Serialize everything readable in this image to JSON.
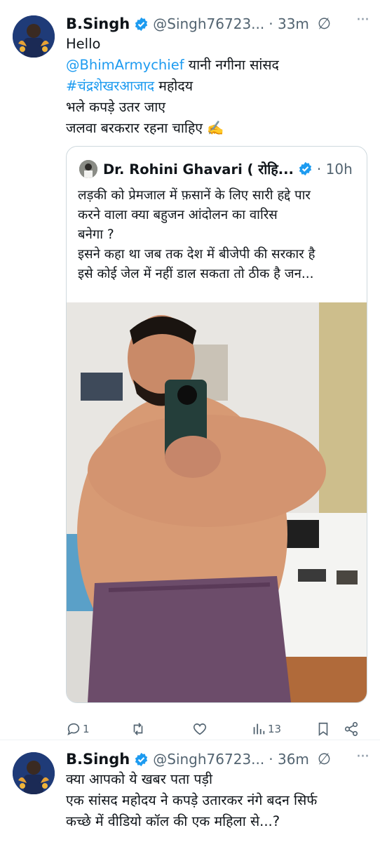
{
  "tweet1": {
    "name": "B.Singh",
    "handle": "@Singh76723...",
    "time": "· 33m",
    "more": "···",
    "lines": {
      "l1": "Hello",
      "l2_link": "@BhimArmychief",
      "l2_rest": " यानी नगीना सांसद",
      "l3_link": "#चंद्रशेखरआजाद",
      "l3_rest": " महोदय",
      "l4": "भले कपड़े उतर जाए",
      "l5": "जलवा बरकरार रहना चाहिए ✍️"
    },
    "quote": {
      "name": "Dr. Rohini Ghavari ( रोहि...",
      "time": "· 10h",
      "lines": [
        "लड़की को प्रेमजाल में फ़सानें के लिए सारी हद्दे पार",
        "करने वाला क्या बहुजन आंदोलन का वारिस",
        "बनेगा ?",
        "इसने कहा था जब तक देश में बीजेपी की सरकार है",
        "इसे कोई जेल में नहीं डाल सकता तो ठीक है जन..."
      ]
    },
    "actions": {
      "replies": "1",
      "retweets": "",
      "likes": "",
      "views": "13"
    }
  },
  "tweet2": {
    "name": "B.Singh",
    "handle": "@Singh76723...",
    "time": "· 36m",
    "more": "···",
    "lines": {
      "l1": "क्या आपको ये खबर पता पड़ी",
      "l2": "एक सांसद महोदय ने कपड़े उतारकर नंगे बदन सिर्फ",
      "l3": "कच्छे में वीडियो कॉल की एक महिला से...?"
    }
  },
  "colors": {
    "accent": "#1d9bf0",
    "secondary_text": "#536471",
    "border": "#cfd9de"
  }
}
